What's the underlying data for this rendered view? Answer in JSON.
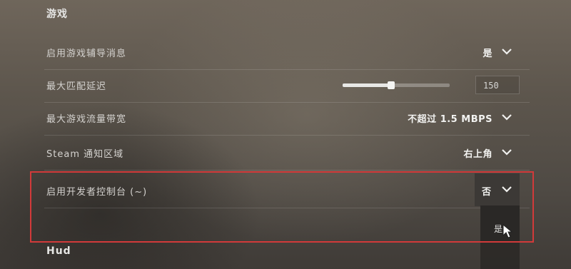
{
  "sections": {
    "game_title": "游戏",
    "hud_title": "Hud"
  },
  "settings": [
    {
      "label": "启用游戏辅导消息",
      "value": "是"
    },
    {
      "label": "最大匹配延迟",
      "slider_value": "150",
      "slider_percent": 45
    },
    {
      "label": "最大游戏流量带宽",
      "value": "不超过 1.5 MBPS"
    },
    {
      "label": "Steam 通知区域",
      "value": "右上角"
    },
    {
      "label": "启用开发者控制台 (~)",
      "value": "否"
    }
  ],
  "dropdown_menu": {
    "options": [
      "是"
    ]
  },
  "colors": {
    "highlight": "#d23a3a"
  }
}
